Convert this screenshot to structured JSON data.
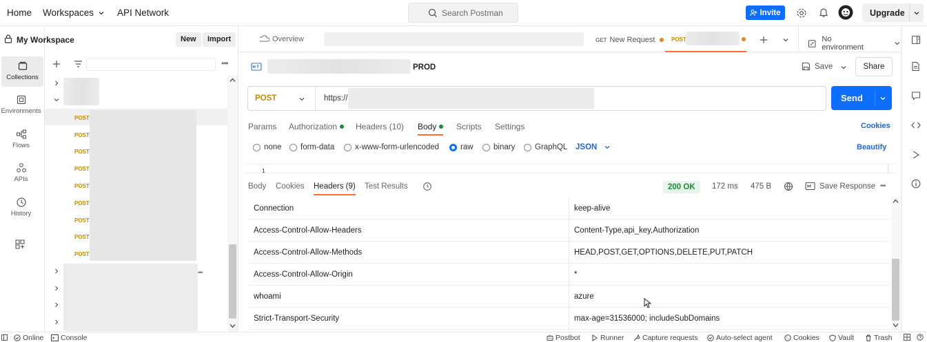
{
  "topbar": {
    "home": "Home",
    "workspaces": "Workspaces",
    "api_network": "API Network",
    "search_placeholder": "Search Postman",
    "invite": "Invite",
    "upgrade": "Upgrade"
  },
  "rail": {
    "items": [
      {
        "label": "Collections",
        "icon": "collections-icon"
      },
      {
        "label": "Environments",
        "icon": "environments-icon"
      },
      {
        "label": "Flows",
        "icon": "flows-icon"
      },
      {
        "label": "APIs",
        "icon": "apis-icon"
      },
      {
        "label": "History",
        "icon": "history-icon"
      }
    ]
  },
  "sidebar": {
    "workspace_name": "My Workspace",
    "new_label": "New",
    "import_label": "Import",
    "method_label": "POST"
  },
  "tabs": {
    "overview": "Overview",
    "tab1_method": "GET",
    "tab1_name": "New Request",
    "tab2_method": "POST",
    "environment": "No environment"
  },
  "request": {
    "name_suffix": "PROD",
    "save": "Save",
    "share": "Share",
    "method": "POST",
    "url_prefix": "https://",
    "send": "Send",
    "tabs": {
      "params": "Params",
      "authorization": "Authorization",
      "headers": "Headers (10)",
      "body": "Body",
      "scripts": "Scripts",
      "settings": "Settings"
    },
    "cookies": "Cookies",
    "body_types": {
      "none": "none",
      "form_data": "form-data",
      "urlencoded": "x-www-form-urlencoded",
      "raw": "raw",
      "binary": "binary",
      "graphql": "GraphQL"
    },
    "format": "JSON",
    "beautify": "Beautify",
    "editor_line": "1"
  },
  "response": {
    "tabs": {
      "body": "Body",
      "cookies": "Cookies",
      "headers": "Headers (9)",
      "test_results": "Test Results"
    },
    "status": "200 OK",
    "time": "172 ms",
    "size": "475 B",
    "save_response": "Save Response",
    "headers": [
      {
        "key": "Connection",
        "value": "keep-alive"
      },
      {
        "key": "Access-Control-Allow-Headers",
        "value": "Content-Type,api_key,Authorization"
      },
      {
        "key": "Access-Control-Allow-Methods",
        "value": "HEAD,POST,GET,OPTIONS,DELETE,PUT,PATCH"
      },
      {
        "key": "Access-Control-Allow-Origin",
        "value": "*"
      },
      {
        "key": "whoami",
        "value": "azure"
      },
      {
        "key": "Strict-Transport-Security",
        "value": "max-age=31536000; includeSubDomains"
      }
    ]
  },
  "statusbar": {
    "online": "Online",
    "console": "Console",
    "postbot": "Postbot",
    "runner": "Runner",
    "capture": "Capture requests",
    "agent": "Auto-select agent",
    "cookies": "Cookies",
    "vault": "Vault",
    "trash": "Trash"
  },
  "colors": {
    "accent": "#0d6efd",
    "post": "#c48a00",
    "ok": "#1a8a3c",
    "active_tab": "#ff6c37"
  }
}
